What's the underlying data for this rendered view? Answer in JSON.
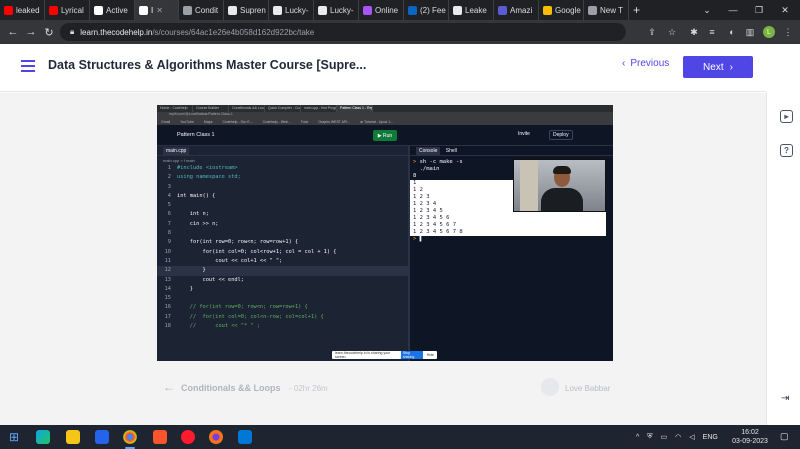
{
  "browser": {
    "tabs": [
      {
        "label": "leaked",
        "color": "#ff0000"
      },
      {
        "label": "Lyrical",
        "color": "#ff0000"
      },
      {
        "label": "Active",
        "color": "#ffffff"
      },
      {
        "label": "I",
        "color": "#ffffff",
        "active": true
      },
      {
        "label": "Condit",
        "color": "#9aa0a6"
      },
      {
        "label": "Supren",
        "color": "#e8eaed"
      },
      {
        "label": "Lucky-",
        "color": "#e8eaed"
      },
      {
        "label": "Lucky-",
        "color": "#e8eaed"
      },
      {
        "label": "Online",
        "color": "#a855f7"
      },
      {
        "label": "(2) Fee",
        "color": "#0a66c2"
      },
      {
        "label": "Leake",
        "color": "#e8eaed"
      },
      {
        "label": "Amazi",
        "color": "#5b5bd6"
      },
      {
        "label": "Google",
        "color": "#fbbc05"
      },
      {
        "label": "New T",
        "color": "#9aa0a6"
      }
    ],
    "new_tab_glyph": "+",
    "url_host": "learn.thecodehelp.in",
    "url_path": "/s/courses/64ac1e26e4b058d162d922bc/take",
    "profile_initial": "L"
  },
  "course": {
    "title": "Data Structures & Algorithms Master Course [Supre...",
    "previous_label": "Previous",
    "next_label": "Next"
  },
  "video": {
    "tabs": [
      "Home - Codehelp",
      "Course Builder",
      "Conditionals && Loops",
      "Quick Compiler - Codehelp",
      "main.cpp - first Program",
      "Pattern Class 1 - Replit"
    ],
    "address": "replit.com/@LoveBabbar/Pattern-Class-1",
    "bookmarks": [
      "Gmail",
      "YouTube",
      "Maps",
      "Codehelp - Our E...",
      "Codehelp - Web...",
      "Todo",
      "Graphs WEST API...",
      "ar Tutorial - Upod 1..."
    ],
    "project_name": "Pattern Class 1",
    "run_label": "Run",
    "invite_label": "Invite",
    "deploy_label": "Deploy",
    "editor_tab": "main.cpp",
    "breadcrumb": "main.cpp > f main",
    "code_lines": [
      {
        "n": "1",
        "t": "#include <iostream>",
        "k": "kw"
      },
      {
        "n": "2",
        "t": "using namespace std;",
        "k": "kw"
      },
      {
        "n": "3",
        "t": "",
        "k": ""
      },
      {
        "n": "4",
        "t": "int main() {",
        "k": ""
      },
      {
        "n": "5",
        "t": "",
        "k": ""
      },
      {
        "n": "6",
        "t": "    int n;",
        "k": ""
      },
      {
        "n": "7",
        "t": "    cin >> n;",
        "k": ""
      },
      {
        "n": "8",
        "t": "",
        "k": ""
      },
      {
        "n": "9",
        "t": "    for(int row=0; row<n; row=row+1) {",
        "k": ""
      },
      {
        "n": "10",
        "t": "        for(int col=0; col<row+1; col = col + 1) {",
        "k": ""
      },
      {
        "n": "11",
        "t": "            cout << col+1 << \" \";",
        "k": ""
      },
      {
        "n": "12",
        "t": "        }",
        "k": "",
        "hl": true
      },
      {
        "n": "13",
        "t": "        cout << endl;",
        "k": ""
      },
      {
        "n": "14",
        "t": "    }",
        "k": ""
      },
      {
        "n": "15",
        "t": "",
        "k": ""
      },
      {
        "n": "16",
        "t": "    // for(int row=0; row<n; row=row+1) {",
        "k": "cm"
      },
      {
        "n": "17",
        "t": "    //  for(int col=0; col<n-row; col=col+1) {",
        "k": "cm"
      },
      {
        "n": "18",
        "t": "    //      cout << \"* \" ;",
        "k": "cm"
      }
    ],
    "console_tab": "Console",
    "shell_tab": "Shell",
    "console_cmd1": "sh -c make -s",
    "console_cmd2": "./main",
    "console_input": "8",
    "console_output": [
      "1",
      "1 2",
      "1 2 3",
      "1 2 3 4",
      "1 2 3 4 5",
      "1 2 3 4 5 6",
      "1 2 3 4 5 6 7",
      "1 2 3 4 5 6 7 8"
    ],
    "share_text": "learn.thecodehelp.in is sharing your screen.",
    "share_stop": "Stop sharing",
    "share_hide": "Hide"
  },
  "lesson": {
    "title": "Conditionals && Loops",
    "duration": "- 02hr 26m",
    "author": "Love Babbar"
  },
  "taskbar": {
    "tray_lang": "ENG",
    "time": "16:02",
    "date": "03-09-2023"
  }
}
